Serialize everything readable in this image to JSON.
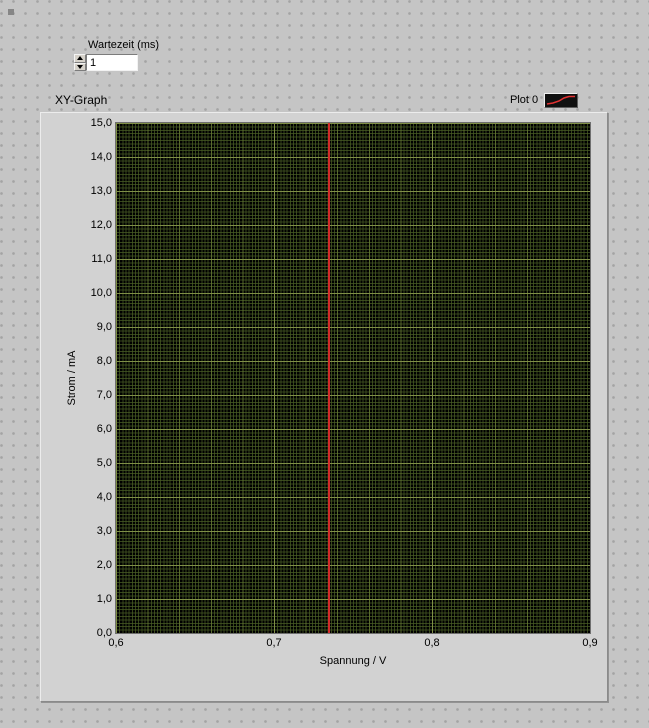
{
  "wait_control": {
    "label": "Wartezeit (ms)",
    "value": "1"
  },
  "graph": {
    "title": "XY-Graph",
    "legend": {
      "plot_label": "Plot 0"
    },
    "y_axis": {
      "label": "Strom / mA",
      "ticks": [
        "15,0",
        "14,0",
        "13,0",
        "12,0",
        "11,0",
        "10,0",
        "9,0",
        "8,0",
        "7,0",
        "6,0",
        "5,0",
        "4,0",
        "3,0",
        "2,0",
        "1,0",
        "0,0"
      ]
    },
    "x_axis": {
      "label": "Spannung / V",
      "ticks": [
        "0,6",
        "0,7",
        "0,8",
        "0,9"
      ]
    },
    "colors": {
      "plot_background": "#000000",
      "grid_minor": "#3c5020",
      "grid_major": "#7f8f46",
      "series": "#d42a2a"
    }
  },
  "chart_data": {
    "type": "line",
    "title": "XY-Graph",
    "xlabel": "Spannung / V",
    "ylabel": "Strom / mA",
    "xlim": [
      0.6,
      0.9
    ],
    "ylim": [
      0,
      15
    ],
    "x_ticks": [
      0.6,
      0.7,
      0.8,
      0.9
    ],
    "y_tick_step": 1.0,
    "grid": "on",
    "legend_position": "top-right",
    "series": [
      {
        "name": "Plot 0",
        "color": "#d42a2a",
        "x": [
          0.735,
          0.735
        ],
        "y": [
          0,
          15
        ]
      }
    ]
  }
}
